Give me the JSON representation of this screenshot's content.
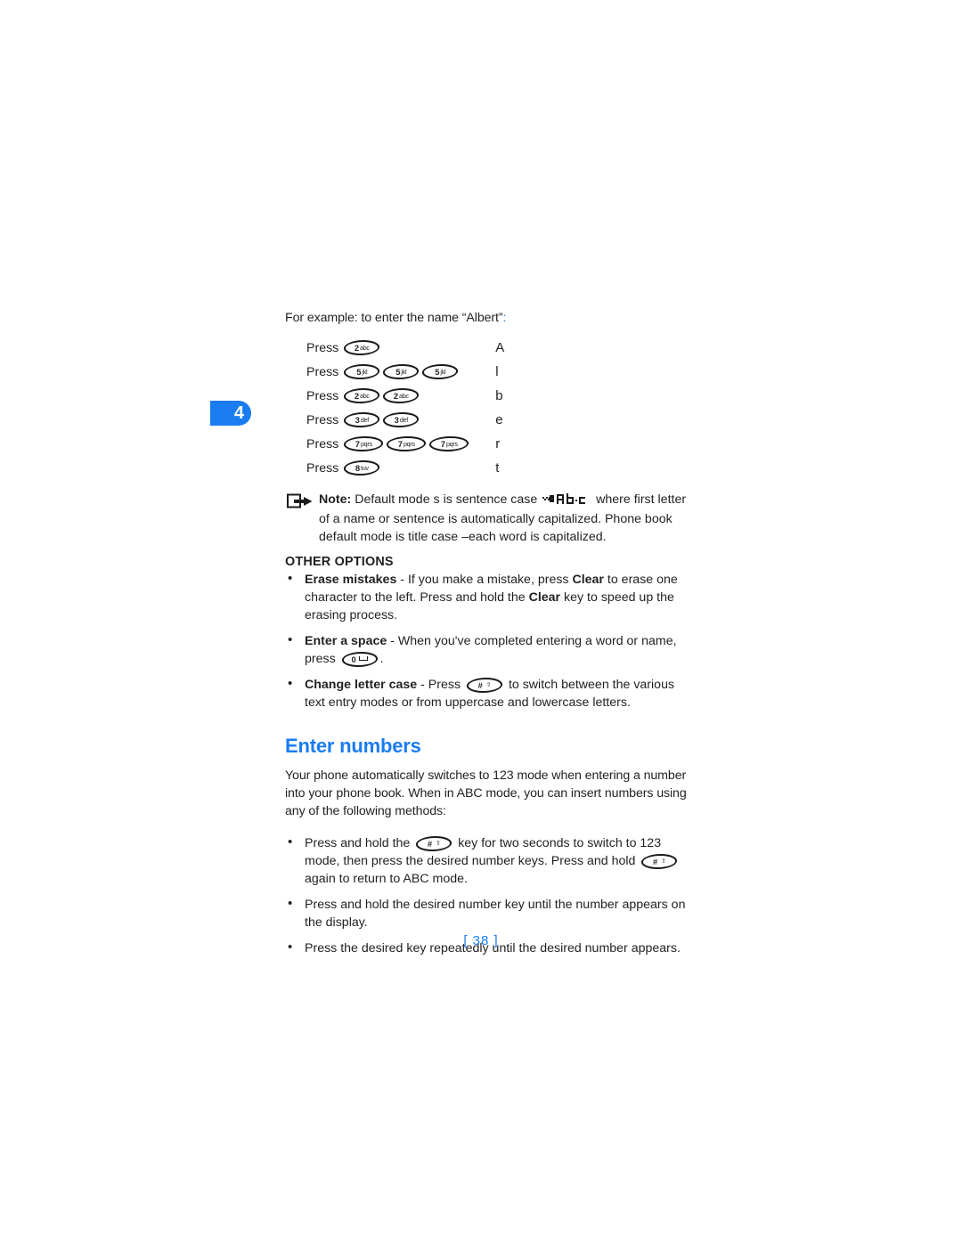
{
  "chapter_tab": {
    "number": "4"
  },
  "intro": {
    "text": "For example: to enter the name “Albert”",
    "trailing_colon": ":"
  },
  "press_table": {
    "press_label": "Press",
    "rows": [
      {
        "keys": [
          {
            "num": "2",
            "sub": "abc"
          }
        ],
        "result": "A"
      },
      {
        "keys": [
          {
            "num": "5",
            "sub": "jkl"
          },
          {
            "num": "5",
            "sub": "jkl"
          },
          {
            "num": "5",
            "sub": "jkl"
          }
        ],
        "result": "l"
      },
      {
        "keys": [
          {
            "num": "2",
            "sub": "abc"
          },
          {
            "num": "2",
            "sub": "abc"
          }
        ],
        "result": "b"
      },
      {
        "keys": [
          {
            "num": "3",
            "sub": "def"
          },
          {
            "num": "3",
            "sub": "def"
          }
        ],
        "result": "e"
      },
      {
        "keys": [
          {
            "num": "7",
            "sub": "pqrs"
          },
          {
            "num": "7",
            "sub": "pqrs"
          },
          {
            "num": "7",
            "sub": "pqrs"
          }
        ],
        "result": "r"
      },
      {
        "keys": [
          {
            "num": "8",
            "sub": "tuv"
          }
        ],
        "result": "t"
      }
    ]
  },
  "note": {
    "label": "Note:",
    "part1": " Default mode s is sentence case ",
    "indicator_alt": "Abc",
    "part2": " where first letter of a name or sentence is automatically capitalized. Phone book default mode is title case –each word is capitalized."
  },
  "other_options": {
    "heading": "OTHER OPTIONS",
    "items": [
      {
        "term": "Erase mistakes",
        "text_a": " - If you make a mistake, press ",
        "strong_a": "Clear",
        "text_b": " to erase one character to the left. Press and hold the ",
        "strong_b": "Clear",
        "text_c": " key to speed up the erasing process."
      },
      {
        "term": "Enter a space",
        "text_a": " - When you've completed entering a word or name, press ",
        "key": {
          "num": "0",
          "sub": "space"
        },
        "text_b": "."
      },
      {
        "term": "Change letter case",
        "text_a": " - Press ",
        "key": {
          "num": "#",
          "sub": "shift"
        },
        "text_b": " to switch between the various text entry modes or from uppercase and lowercase letters."
      }
    ]
  },
  "enter_numbers": {
    "heading": "Enter numbers",
    "paragraph": "Your phone automatically switches to 123 mode when entering a number into your phone book. When in ABC mode, you can insert numbers using any of the following methods:",
    "bullets": [
      {
        "text_a": "Press and hold the ",
        "key1": {
          "num": "#",
          "sub": "shift"
        },
        "text_b": " key for two seconds to switch to 123 mode, then press the desired number keys. Press and hold ",
        "key2": {
          "num": "#",
          "sub": "shift"
        },
        "text_c": " again to return to ABC mode."
      },
      {
        "text_a": "Press and hold the desired number key until the number appears on the display."
      },
      {
        "text_a": "Press the desired key repeatedly until the desired number appears."
      }
    ]
  },
  "footer": {
    "page_number": "[ 38 ]"
  },
  "colors": {
    "accent_blue": "#1a7cf0",
    "body_text": "#231f20",
    "key_outline": "#1b1b1b"
  }
}
